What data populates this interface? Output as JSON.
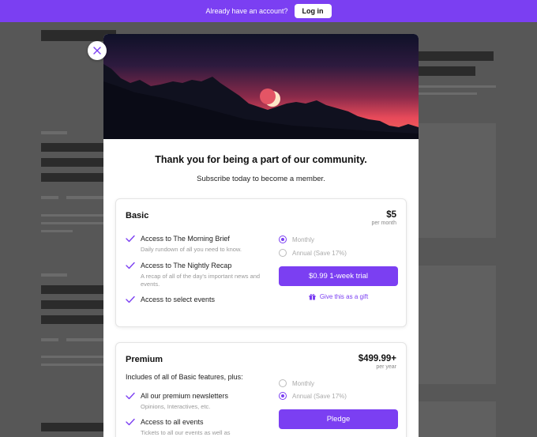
{
  "topbar": {
    "message": "Already have an account?",
    "login_label": "Log in"
  },
  "modal": {
    "title": "Thank you for being a part of our community.",
    "subtitle": "Subscribe today to become a member."
  },
  "plans": {
    "basic": {
      "name": "Basic",
      "price": "$5",
      "period": "per month",
      "features": [
        {
          "name": "Access to The Morning Brief",
          "desc": "Daily rundown of all you need to know."
        },
        {
          "name": "Access to The Nightly Recap",
          "desc": "A recap of all of the day's important news and events."
        },
        {
          "name": "Access to select events",
          "desc": ""
        }
      ],
      "options": [
        {
          "label": "Monthly",
          "selected": true
        },
        {
          "label": "Annual (Save 17%)",
          "selected": false
        }
      ],
      "cta": "$0.99 1-week trial",
      "gift": "Give this as a gift"
    },
    "premium": {
      "name": "Premium",
      "price": "$499.99+",
      "period": "per year",
      "includes": "Includes of all of Basic features, plus:",
      "features": [
        {
          "name": "All our premium newsletters",
          "desc": "Opinions, Interactives, etc."
        },
        {
          "name": "Access to all events",
          "desc": "Tickets to all our events as well as"
        }
      ],
      "options": [
        {
          "label": "Monthly",
          "selected": false
        },
        {
          "label": "Annual (Save 17%)",
          "selected": true
        }
      ],
      "cta": "Pledge"
    }
  },
  "colors": {
    "accent": "#7b3ff2"
  }
}
